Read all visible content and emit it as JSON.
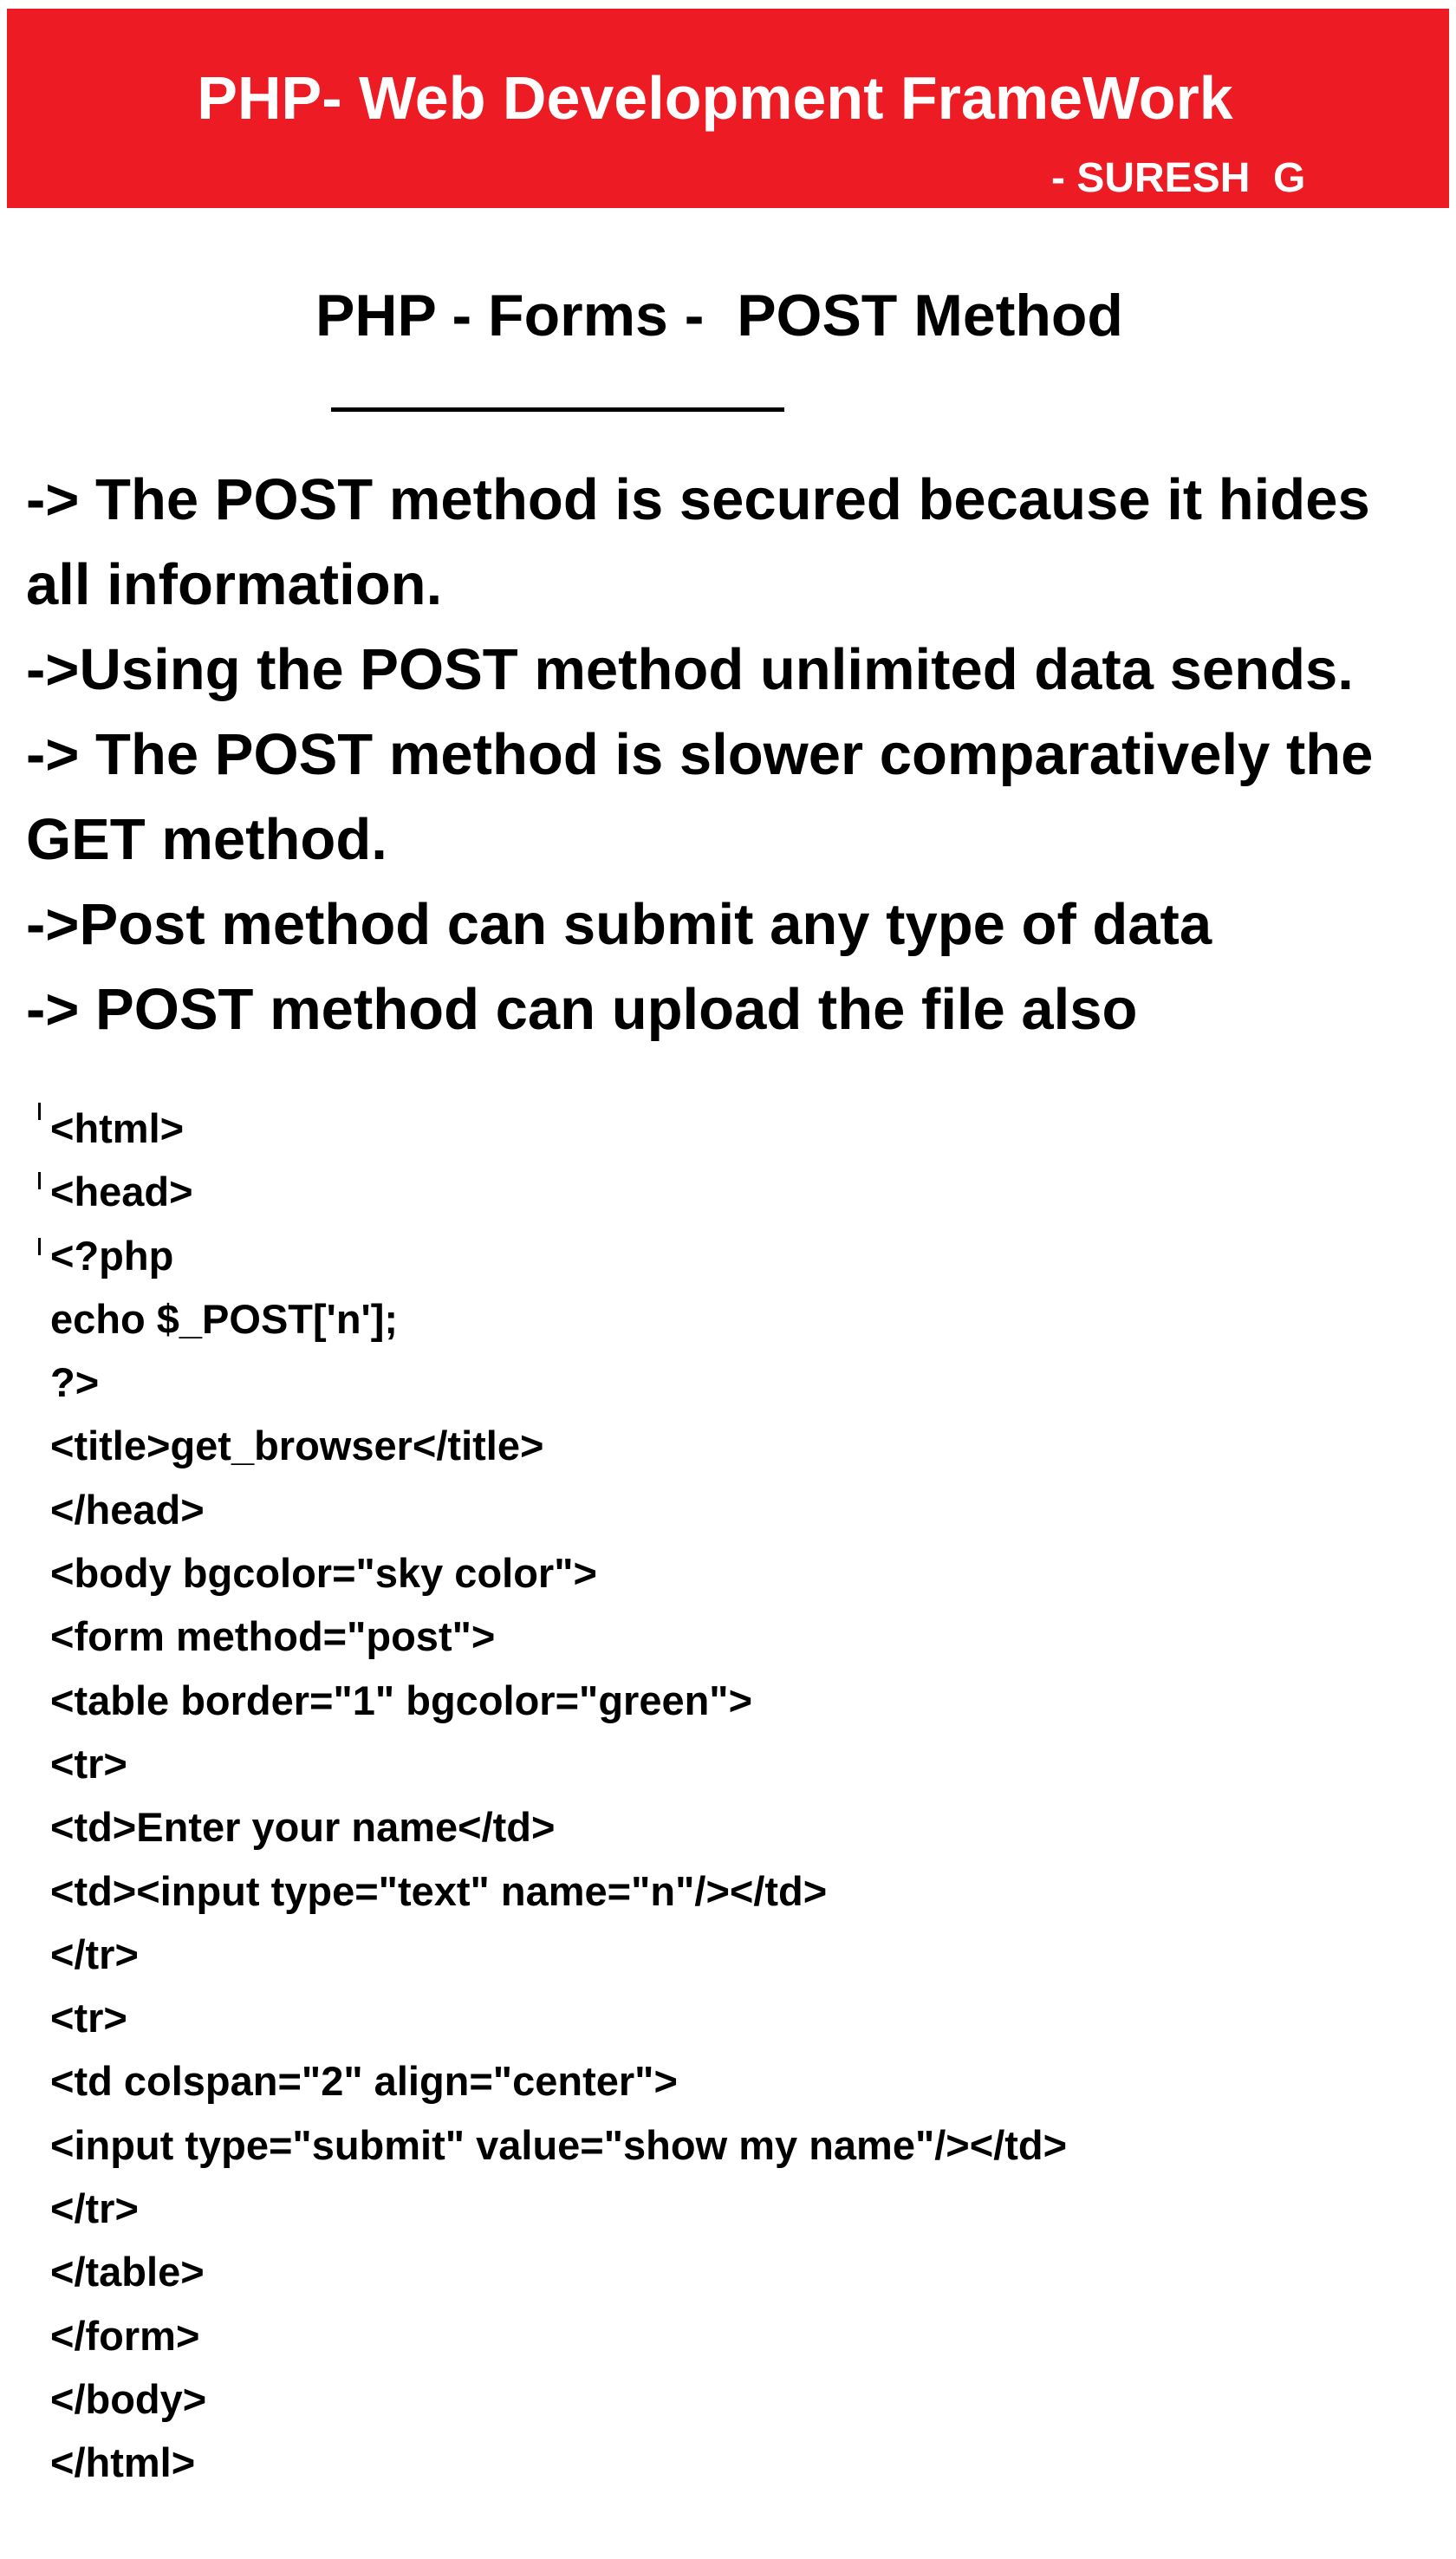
{
  "banner": {
    "title": "PHP- Web Development FrameWork",
    "author": "- SURESH  G",
    "background_color": "#ed1c24"
  },
  "page_title": "PHP - Forms -  POST Method",
  "points": [
    "-> The POST method is secured because it hides all information.",
    "->Using the POST method unlimited data sends.",
    "-> The POST method is slower comparatively the GET method.",
    "->Post method can submit any type of data",
    "-> POST method can upload the file also"
  ],
  "code_lines": [
    "<html>",
    "<head>",
    "<?php",
    "echo $_POST['n'];",
    "?>",
    "<title>get_browser</title>",
    "</head>",
    "<body bgcolor=\"sky color\">",
    "<form method=\"post\">",
    "<table border=\"1\" bgcolor=\"green\">",
    "<tr>",
    "<td>Enter your name</td>",
    "<td><input type=\"text\" name=\"n\"/></td>",
    "</tr>",
    "<tr>",
    "<td colspan=\"2\" align=\"center\">",
    "<input type=\"submit\" value=\"show my name\"/></td>",
    "</tr>",
    "</table>",
    "</form>",
    "</body>",
    "</html>"
  ]
}
